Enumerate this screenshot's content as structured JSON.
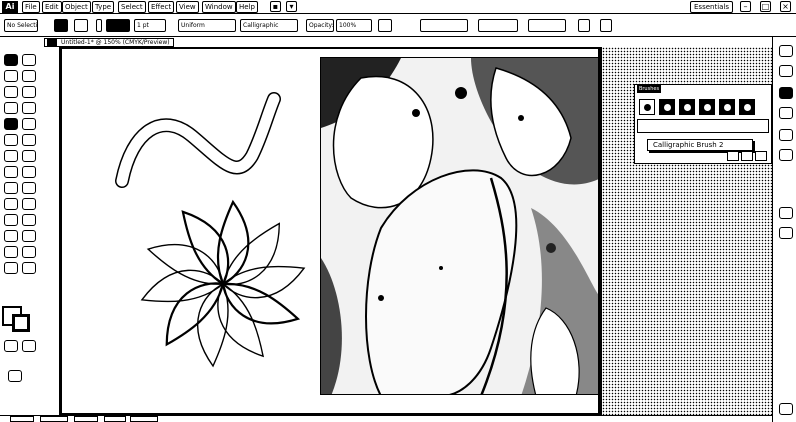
{
  "app": {
    "logo": "Ai",
    "workspace": "Essentials"
  },
  "menu": [
    "File",
    "Edit",
    "Object",
    "Type",
    "Select",
    "Effect",
    "View",
    "Window",
    "Help"
  ],
  "control_bar": {
    "selection_label": "No Selection",
    "stroke_weight": "1 pt",
    "profile": "Uniform",
    "brush": "Calligraphic",
    "opacity_label": "Opacity:",
    "opacity_value": "100%"
  },
  "document_tab": {
    "title": "Untitled-1* @ 150% (CMYK/Preview)"
  },
  "brushes_panel": {
    "tab_label": "Brushes",
    "tooltip": "Calligraphic Brush 2"
  },
  "colors": {
    "ui_background": "#ffffff",
    "foreground": "#000000"
  }
}
